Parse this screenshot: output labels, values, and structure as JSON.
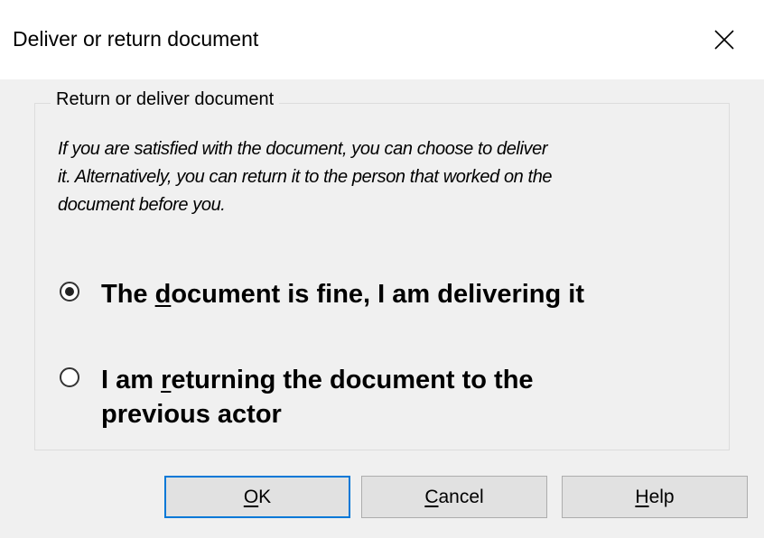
{
  "window": {
    "title": "Deliver or return document",
    "close_icon": "close-icon"
  },
  "group": {
    "legend": "Return or deliver document",
    "description_lines": [
      "If you are satisfied with the document, you can choose to deliver",
      "it. Alternatively, you can return it to the person that worked on the",
      "document before you."
    ]
  },
  "options": {
    "deliver": {
      "pre": "The ",
      "key": "d",
      "post": "ocument is fine, I am delivering it",
      "selected": true
    },
    "return": {
      "line1_pre": "I am ",
      "key": "r",
      "line1_post": "eturning the document to the",
      "line2": "previous actor",
      "selected": false
    }
  },
  "buttons": {
    "ok": {
      "key": "O",
      "rest": "K"
    },
    "cancel": {
      "key": "C",
      "rest": "ancel"
    },
    "help": {
      "key": "H",
      "rest": "elp"
    }
  },
  "colors": {
    "default_button_border": "#0078d7",
    "dialog_background": "#f0f0f0",
    "title_background": "#ffffff"
  }
}
